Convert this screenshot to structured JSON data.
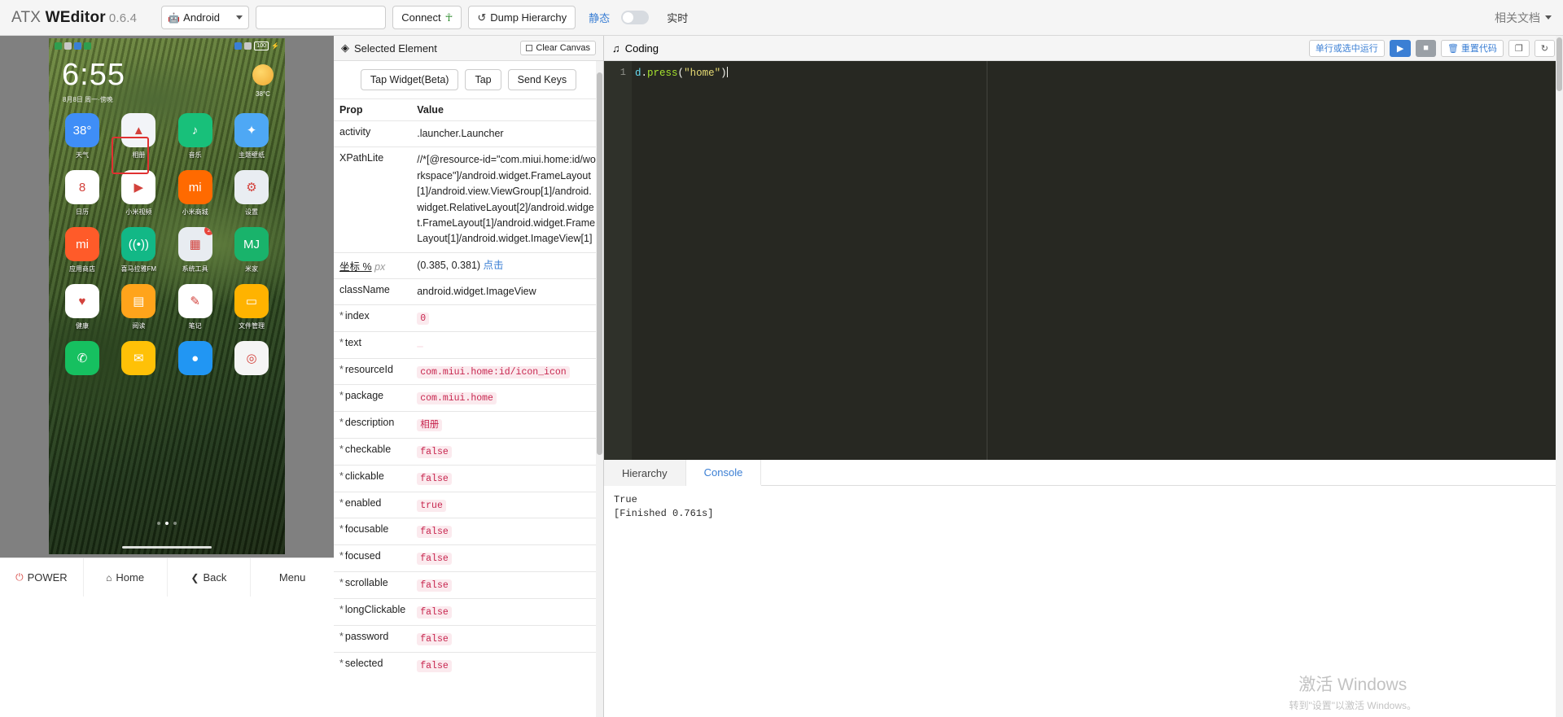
{
  "topbar": {
    "brand_prefix": "ATX ",
    "brand_bold": "WEditor",
    "version": "0.6.4",
    "platform_select": "Android",
    "device_input_value": "",
    "device_input_placeholder": "",
    "connect_label": "Connect",
    "dump_label": "Dump Hierarchy",
    "mode_static": "静态",
    "mode_live": "实时",
    "docs_label": "相关文档"
  },
  "phone": {
    "status_battery": "100",
    "clock": "6:55",
    "date": "8月8日 周一·傍晚",
    "weather_temp": "38°C",
    "rows": [
      [
        {
          "name": "天气",
          "glyph": "38°",
          "color": "#3f8ef7"
        },
        {
          "name": "相册",
          "glyph": "▲",
          "color": "#f2f4f8"
        },
        {
          "name": "音乐",
          "glyph": "♪",
          "color": "#18c07a"
        },
        {
          "name": "主题壁纸",
          "glyph": "✦",
          "color": "#4ea8f5"
        }
      ],
      [
        {
          "name": "日历",
          "glyph": "8",
          "color": "#ffffff"
        },
        {
          "name": "小米视频",
          "glyph": "▶",
          "color": "#ffffff"
        },
        {
          "name": "小米商城",
          "glyph": "mi",
          "color": "#ff6a00"
        },
        {
          "name": "设置",
          "glyph": "⚙",
          "color": "#e9edf2"
        }
      ],
      [
        {
          "name": "应用商店",
          "glyph": "mi",
          "color": "#ff5b29"
        },
        {
          "name": "喜马拉雅FM",
          "glyph": "((•))",
          "color": "#12b886"
        },
        {
          "name": "系统工具",
          "glyph": "▦",
          "color": "#e8ecf1",
          "badge": "2"
        },
        {
          "name": "米家",
          "glyph": "MJ",
          "color": "#19b36b"
        }
      ],
      [
        {
          "name": "健康",
          "glyph": "♥",
          "color": "#ffffff"
        },
        {
          "name": "阅读",
          "glyph": "▤",
          "color": "#ffa41b"
        },
        {
          "name": "笔记",
          "glyph": "✎",
          "color": "#ffffff"
        },
        {
          "name": "文件管理",
          "glyph": "▭",
          "color": "#ffb300"
        }
      ],
      [
        {
          "name": "",
          "glyph": "✆",
          "color": "#16c060"
        },
        {
          "name": "",
          "glyph": "✉",
          "color": "#ffc107"
        },
        {
          "name": "",
          "glyph": "●",
          "color": "#2196f3"
        },
        {
          "name": "",
          "glyph": "◎",
          "color": "#f5f5f5"
        }
      ]
    ],
    "controls": [
      {
        "icon": "power-icon",
        "glyph": "⏻",
        "label": "POWER"
      },
      {
        "icon": "home-icon",
        "glyph": "⌂",
        "label": "Home"
      },
      {
        "icon": "back-icon",
        "glyph": "❮",
        "label": "Back"
      },
      {
        "icon": "menu-icon",
        "glyph": "",
        "label": "Menu"
      }
    ]
  },
  "selected_element": {
    "title": "Selected Element",
    "clear_canvas_label": "Clear Canvas",
    "actions": [
      "Tap Widget(Beta)",
      "Tap",
      "Send Keys"
    ],
    "columns": [
      "Prop",
      "Value"
    ],
    "rows": [
      {
        "key": "activity",
        "star": false,
        "value": ".launcher.Launcher",
        "style": "plain"
      },
      {
        "key": "XPathLite",
        "star": false,
        "value": "//*[@resource-id=\"com.miui.home:id/workspace\"]/android.widget.FrameLayout[1]/android.view.ViewGroup[1]/android.widget.RelativeLayout[2]/android.widget.FrameLayout[1]/android.widget.FrameLayout[1]/android.widget.ImageView[1]",
        "style": "plain"
      },
      {
        "key": "坐标",
        "star": false,
        "value": "(0.385, 0.381)",
        "style": "coord",
        "unit_pct": "%",
        "unit_px": "px",
        "link": "点击"
      },
      {
        "key": "className",
        "star": false,
        "value": "android.widget.ImageView",
        "style": "plain"
      },
      {
        "key": "index",
        "star": true,
        "value": "0",
        "style": "code"
      },
      {
        "key": "text",
        "star": true,
        "value": "",
        "style": "code"
      },
      {
        "key": "resourceId",
        "star": true,
        "value": "com.miui.home:id/icon_icon",
        "style": "code"
      },
      {
        "key": "package",
        "star": true,
        "value": "com.miui.home",
        "style": "code"
      },
      {
        "key": "description",
        "star": true,
        "value": "相册",
        "style": "code"
      },
      {
        "key": "checkable",
        "star": true,
        "value": "false",
        "style": "code"
      },
      {
        "key": "clickable",
        "star": true,
        "value": "false",
        "style": "code"
      },
      {
        "key": "enabled",
        "star": true,
        "value": "true",
        "style": "code"
      },
      {
        "key": "focusable",
        "star": true,
        "value": "false",
        "style": "code"
      },
      {
        "key": "focused",
        "star": true,
        "value": "false",
        "style": "code"
      },
      {
        "key": "scrollable",
        "star": true,
        "value": "false",
        "style": "code"
      },
      {
        "key": "longClickable",
        "star": true,
        "value": "false",
        "style": "code"
      },
      {
        "key": "password",
        "star": true,
        "value": "false",
        "style": "code"
      },
      {
        "key": "selected",
        "star": true,
        "value": "false",
        "style": "code"
      }
    ]
  },
  "coding": {
    "title": "Coding",
    "tools": {
      "run_selection": "单行或选中运行",
      "play": "▶",
      "stop": "■",
      "reset": "重置代码",
      "copy": "❐",
      "refresh": "↻"
    },
    "line_number": "1",
    "code_obj": "d",
    "code_dot": ".",
    "code_fn": "press",
    "code_open": "(",
    "code_str": "\"home\"",
    "code_close": ")"
  },
  "bottom": {
    "tabs": [
      {
        "label": "Hierarchy",
        "active": false
      },
      {
        "label": "Console",
        "active": true
      }
    ],
    "console_output": "True\n[Finished 0.761s]"
  },
  "watermark": {
    "line1": "激活 Windows",
    "line2": "转到\"设置\"以激活 Windows。"
  }
}
